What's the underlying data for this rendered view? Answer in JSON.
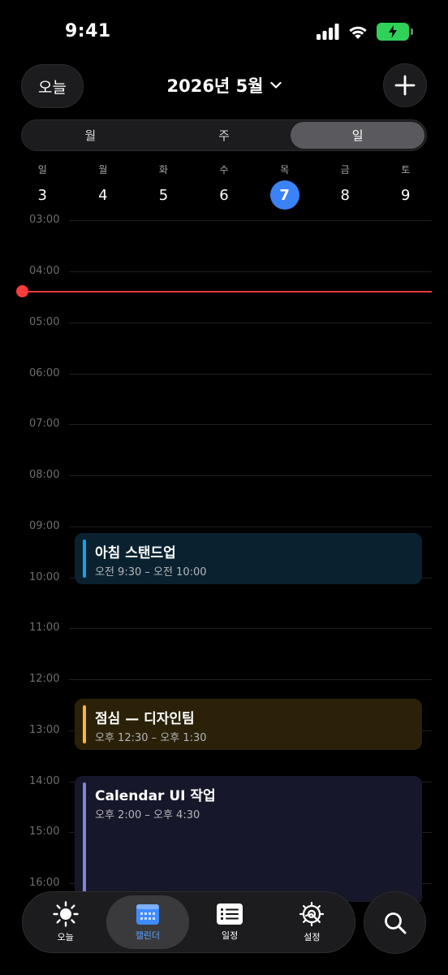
{
  "status_bar": {
    "time": "9:41"
  },
  "header": {
    "today_label": "오늘",
    "month_title": "2026년 5월"
  },
  "segments": [
    {
      "label": "월",
      "active": false
    },
    {
      "label": "주",
      "active": false
    },
    {
      "label": "일",
      "active": true
    }
  ],
  "week": [
    {
      "label": "일",
      "num": "3"
    },
    {
      "label": "월",
      "num": "4"
    },
    {
      "label": "화",
      "num": "5"
    },
    {
      "label": "수",
      "num": "6"
    },
    {
      "label": "목",
      "num": "7",
      "selected": true
    },
    {
      "label": "금",
      "num": "8"
    },
    {
      "label": "토",
      "num": "9"
    }
  ],
  "hours": [
    "03:00",
    "04:00",
    "05:00",
    "06:00",
    "07:00",
    "08:00",
    "09:00",
    "10:00",
    "11:00",
    "12:00",
    "13:00",
    "14:00",
    "15:00",
    "16:00"
  ],
  "events": [
    {
      "title": "아침 스탠드업",
      "time": "오전 9:30 – 오전 10:00",
      "color": "#1aa1e6",
      "bg": "#0a2230"
    },
    {
      "title": "점심 — 디자인팀",
      "time": "오후 12:30 – 오후 1:30",
      "color": "#f5b82e",
      "bg": "#2a2108"
    },
    {
      "title": "Calendar UI 작업",
      "time": "오후 2:00 – 오후 4:30",
      "color": "#7f83d6",
      "bg": "#16172a"
    }
  ],
  "tabs": [
    {
      "label": "오늘",
      "icon": "sun-icon",
      "active": false
    },
    {
      "label": "캘린더",
      "icon": "calendar-icon",
      "active": true
    },
    {
      "label": "일정",
      "icon": "list-icon",
      "active": false
    },
    {
      "label": "설정",
      "icon": "gear-icon",
      "active": false
    }
  ],
  "colors": {
    "accent": "#3b82f6",
    "now_line": "#ff3b3b",
    "tab_active": "#5aa2ff",
    "battery": "#2fd158"
  }
}
